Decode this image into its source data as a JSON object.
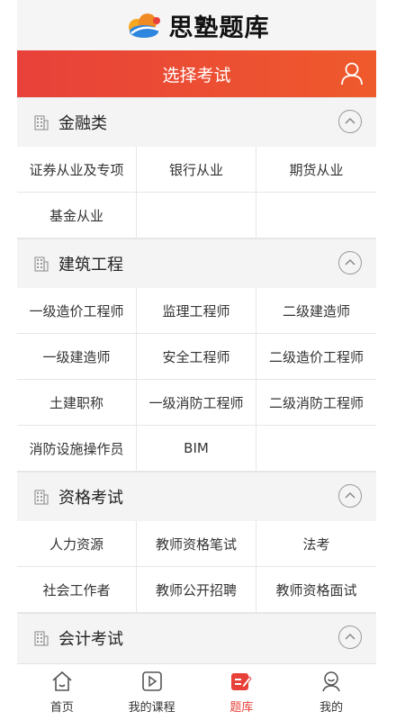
{
  "app": {
    "logo_text": "思塾题库",
    "title": "选择考试"
  },
  "colors": {
    "accent": "#e8413a",
    "accent_end": "#ef5a2c"
  },
  "sections": [
    {
      "title": "金融类",
      "items": [
        "证券从业及专项",
        "银行从业",
        "期货从业",
        "基金从业"
      ]
    },
    {
      "title": "建筑工程",
      "items": [
        "一级造价工程师",
        "监理工程师",
        "二级建造师",
        "一级建造师",
        "安全工程师",
        "二级造价工程师",
        "土建职称",
        "一级消防工程师",
        "二级消防工程师",
        "消防设施操作员",
        "BIM"
      ]
    },
    {
      "title": "资格考试",
      "items": [
        "人力资源",
        "教师资格笔试",
        "法考",
        "社会工作者",
        "教师公开招聘",
        "教师资格面试"
      ]
    },
    {
      "title": "会计考试",
      "items": []
    }
  ],
  "tabbar": {
    "home": "首页",
    "courses": "我的课程",
    "bank": "题库",
    "mine": "我的"
  }
}
